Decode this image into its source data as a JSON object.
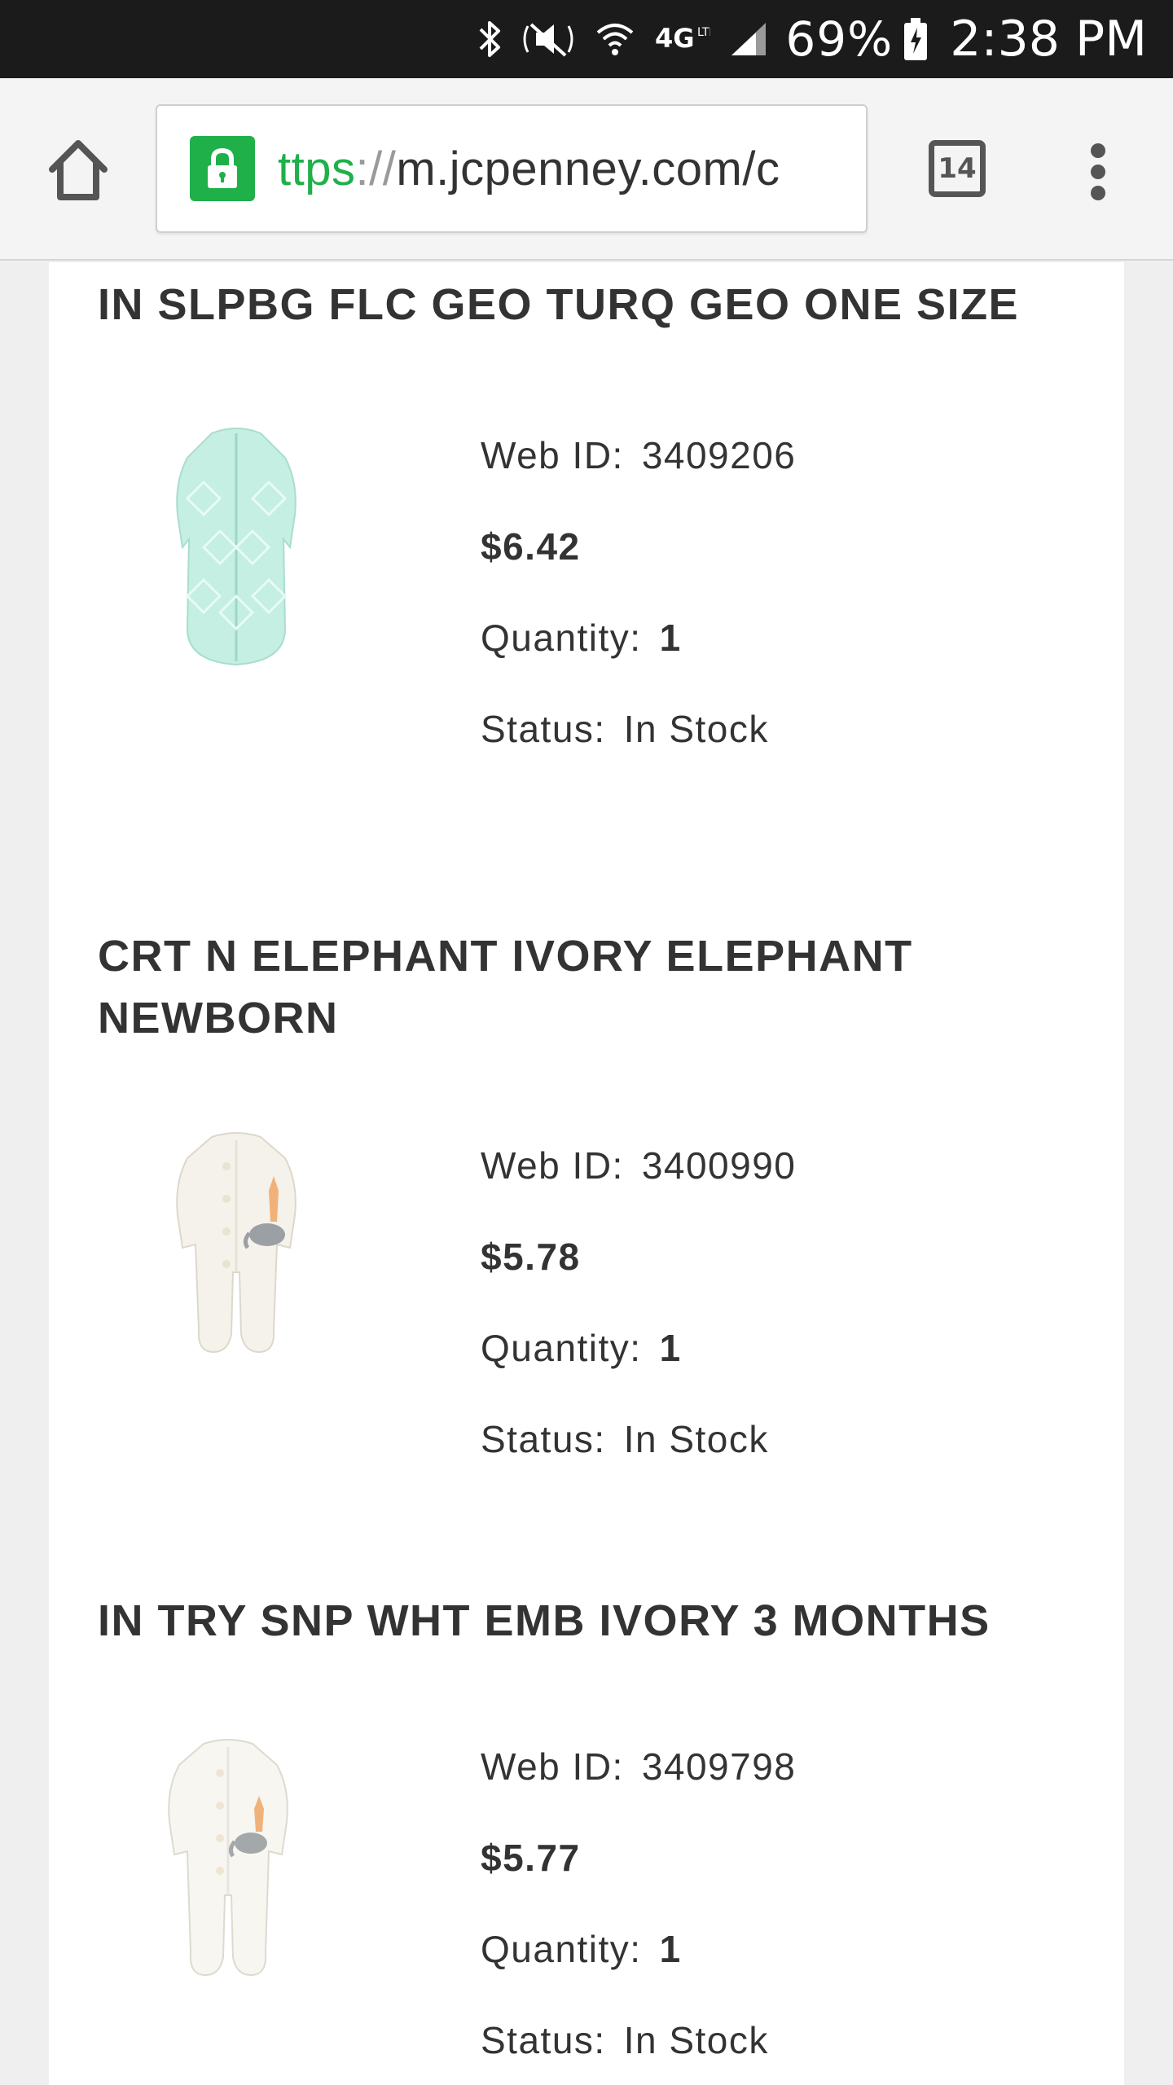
{
  "status_bar": {
    "battery": "69%",
    "time": "2:38 PM",
    "network": "4G",
    "icons": [
      "bluetooth-icon",
      "mute-icon",
      "wifi-icon",
      "4g-icon",
      "signal-icon",
      "battery-charging-icon"
    ]
  },
  "browser": {
    "url_scheme": "ttps",
    "url_sep": "://",
    "url_host": "m.jcpenney.com/c",
    "tab_count": "14",
    "icons": [
      "home-icon",
      "lock-icon",
      "tabs-icon",
      "more-vert-icon"
    ]
  },
  "labels": {
    "web_id": "Web ID:",
    "quantity": "Quantity:",
    "status": "Status:"
  },
  "items": [
    {
      "title": "IN SLPBG FLC GEO TURQ GEO ONE SIZE",
      "web_id": "3409206",
      "price": "$6.42",
      "quantity": "1",
      "status": "In Stock",
      "image": "mint-sleep-bag",
      "color": "#bfeee0"
    },
    {
      "title": "CRT N ELEPHANT IVORY ELEPHANT NEWBORN",
      "web_id": "3400990",
      "price": "$5.78",
      "quantity": "1",
      "status": "In Stock",
      "image": "ivory-footed-sleeper",
      "color": "#f4f2ea"
    },
    {
      "title": "IN TRY SNP WHT EMB IVORY 3 MONTHS",
      "web_id": "3409798",
      "price": "$5.77",
      "quantity": "1",
      "status": "In Stock",
      "image": "white-footed-sleeper",
      "color": "#f7f6f1"
    }
  ]
}
